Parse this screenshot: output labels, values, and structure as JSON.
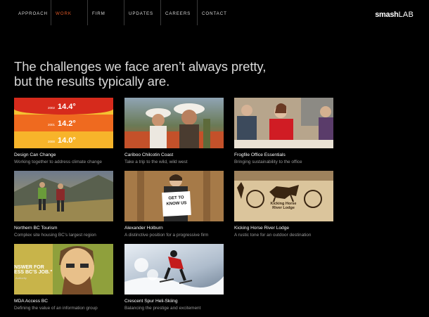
{
  "nav": {
    "items": [
      {
        "label": "APPROACH"
      },
      {
        "label": "WORK"
      },
      {
        "label": "FIRM"
      },
      {
        "label": "UPDATES"
      },
      {
        "label": "CAREERS"
      },
      {
        "label": "CONTACT"
      }
    ],
    "active_index": 1
  },
  "logo": {
    "part1": "smash",
    "part2": "LAB"
  },
  "headline": {
    "line1": "The challenges we face aren’t always pretty,",
    "line2": "but the results typically are."
  },
  "colors": {
    "accent": "#e25a28",
    "background": "#000000"
  },
  "projects": [
    {
      "title": "Design Can Change",
      "desc": "Working together to address climate change",
      "thumb": {
        "temps": [
          "14.4°",
          "14.2°",
          "14.0°"
        ],
        "years": [
          "2002",
          "2001",
          "2000"
        ]
      }
    },
    {
      "title": "Cariboo Chilcotin Coast",
      "desc": "Take a trip to the wild, wild west"
    },
    {
      "title": "Frogfile Office Essentials",
      "desc": "Bringing sustainability to the office"
    },
    {
      "title": "Northern BC Tourism",
      "desc": "Complex site housing BC’s largest region"
    },
    {
      "title": "Alexander Holburn",
      "desc": "A distinctive position for a progressive firm",
      "thumb": {
        "sign_line1": "GET TO",
        "sign_line2": "KNOW US"
      }
    },
    {
      "title": "Kicking Horse River Lodge",
      "desc": "A rustic tone for an outdoor destination",
      "thumb": {
        "line1": "Kicking Horse",
        "line2": "River Lodge"
      }
    },
    {
      "title": "MDA Access BC",
      "desc": "Defining the value of an information group",
      "thumb": {
        "line1": "NSWER FOR",
        "line2": "ESS BC’S JOB.”",
        "sub": "Authority"
      }
    },
    {
      "title": "Crescent Spur Heli-Skiing",
      "desc": "Balancing the prestige and excitement"
    }
  ]
}
